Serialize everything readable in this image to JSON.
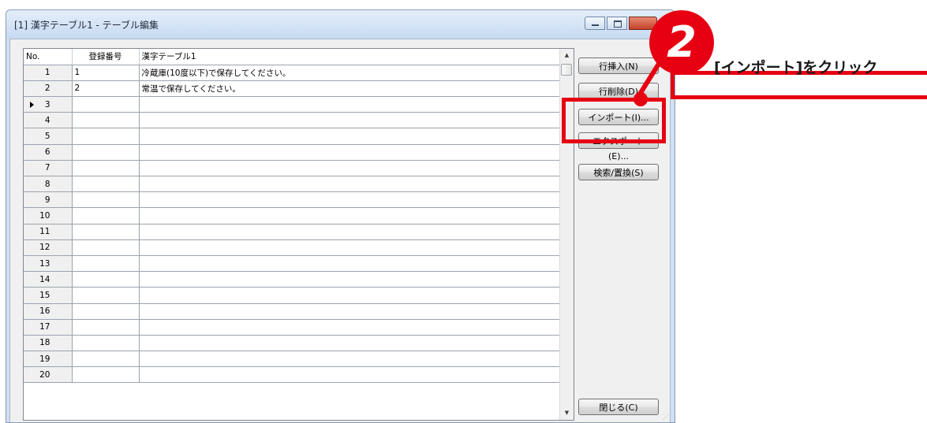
{
  "window": {
    "title": "[1] 漢字テーブル1 - テーブル編集"
  },
  "grid": {
    "columns": [
      "No.",
      "登録番号",
      "漢字テーブル1"
    ],
    "current_row": 3,
    "rows": [
      {
        "no": "1",
        "reg": "1",
        "text": "冷蔵庫(10度以下)で保存してください。"
      },
      {
        "no": "2",
        "reg": "2",
        "text": "常温で保存してください。"
      },
      {
        "no": "3",
        "reg": "",
        "text": ""
      },
      {
        "no": "4",
        "reg": "",
        "text": ""
      },
      {
        "no": "5",
        "reg": "",
        "text": ""
      },
      {
        "no": "6",
        "reg": "",
        "text": ""
      },
      {
        "no": "7",
        "reg": "",
        "text": ""
      },
      {
        "no": "8",
        "reg": "",
        "text": ""
      },
      {
        "no": "9",
        "reg": "",
        "text": ""
      },
      {
        "no": "10",
        "reg": "",
        "text": ""
      },
      {
        "no": "11",
        "reg": "",
        "text": ""
      },
      {
        "no": "12",
        "reg": "",
        "text": ""
      },
      {
        "no": "13",
        "reg": "",
        "text": ""
      },
      {
        "no": "14",
        "reg": "",
        "text": ""
      },
      {
        "no": "15",
        "reg": "",
        "text": ""
      },
      {
        "no": "16",
        "reg": "",
        "text": ""
      },
      {
        "no": "17",
        "reg": "",
        "text": ""
      },
      {
        "no": "18",
        "reg": "",
        "text": ""
      },
      {
        "no": "19",
        "reg": "",
        "text": ""
      },
      {
        "no": "20",
        "reg": "",
        "text": ""
      }
    ]
  },
  "buttons": {
    "insert_row": "行挿入(N)",
    "delete_row": "行削除(D)",
    "import": "インポート(I)...",
    "export": "エクスポート(E)...",
    "search_replace": "検索/置換(S)",
    "close": "閉じる(C)"
  },
  "annotation": {
    "step_number": "2",
    "callout_text": "[インポート]をクリック",
    "accent_color": "#e60012"
  }
}
